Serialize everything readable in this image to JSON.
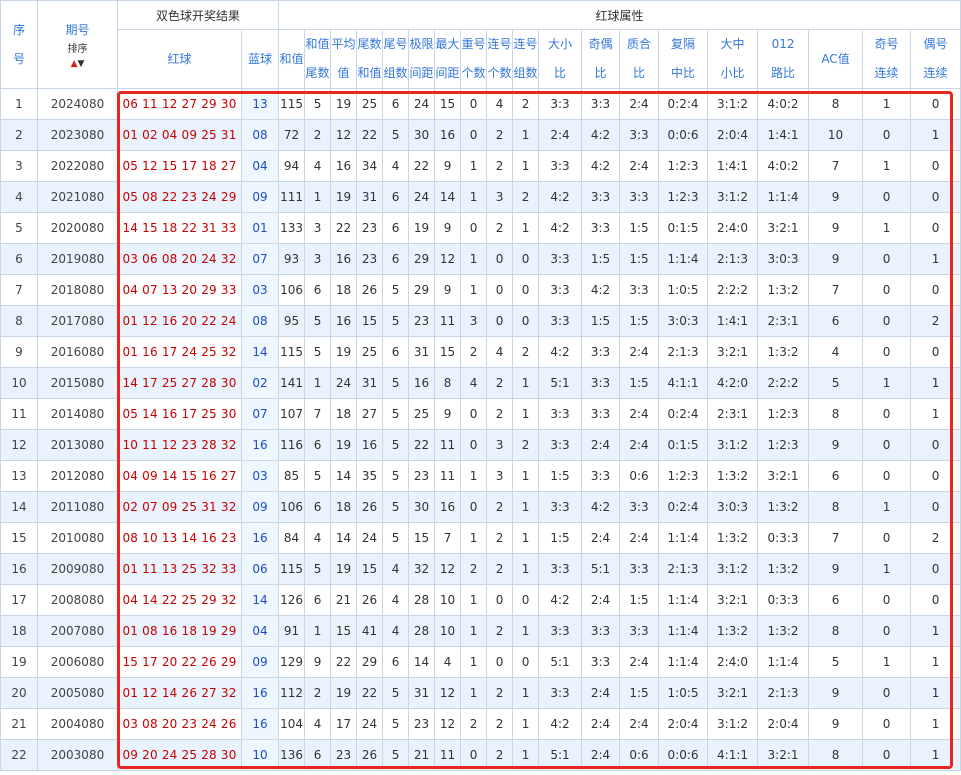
{
  "header": {
    "seq": [
      "序",
      "号"
    ],
    "issue": "期号",
    "sort": "排序",
    "result_group": "双色球开奖结果",
    "red_group": "红球属性",
    "red_ball": "红球",
    "blue_ball": "蓝球",
    "cols": [
      [
        "和值"
      ],
      [
        "和值",
        "尾数"
      ],
      [
        "平均",
        "值"
      ],
      [
        "尾数",
        "和值"
      ],
      [
        "尾号",
        "组数"
      ],
      [
        "极限",
        "间距"
      ],
      [
        "最大",
        "间距"
      ],
      [
        "重号",
        "个数"
      ],
      [
        "连号",
        "个数"
      ],
      [
        "连号",
        "组数"
      ],
      [
        "大小",
        "比"
      ],
      [
        "奇偶",
        "比"
      ],
      [
        "质合",
        "比"
      ],
      [
        "复隔",
        "中比"
      ],
      [
        "大中",
        "小比"
      ],
      [
        "012",
        "路比"
      ],
      [
        "AC值"
      ],
      [
        "奇号",
        "连续"
      ],
      [
        "偶号",
        "连续"
      ]
    ]
  },
  "rows": [
    [
      "1",
      "2024080",
      "06 11 12 27 29 30",
      "13",
      "115",
      "5",
      "19",
      "25",
      "6",
      "24",
      "15",
      "0",
      "4",
      "2",
      "3:3",
      "3:3",
      "2:4",
      "0:2:4",
      "3:1:2",
      "4:0:2",
      "8",
      "1",
      "0"
    ],
    [
      "2",
      "2023080",
      "01 02 04 09 25 31",
      "08",
      "72",
      "2",
      "12",
      "22",
      "5",
      "30",
      "16",
      "0",
      "2",
      "1",
      "2:4",
      "4:2",
      "3:3",
      "0:0:6",
      "2:0:4",
      "1:4:1",
      "10",
      "0",
      "1"
    ],
    [
      "3",
      "2022080",
      "05 12 15 17 18 27",
      "04",
      "94",
      "4",
      "16",
      "34",
      "4",
      "22",
      "9",
      "1",
      "2",
      "1",
      "3:3",
      "4:2",
      "2:4",
      "1:2:3",
      "1:4:1",
      "4:0:2",
      "7",
      "1",
      "0"
    ],
    [
      "4",
      "2021080",
      "05 08 22 23 24 29",
      "09",
      "111",
      "1",
      "19",
      "31",
      "6",
      "24",
      "14",
      "1",
      "3",
      "2",
      "4:2",
      "3:3",
      "3:3",
      "1:2:3",
      "3:1:2",
      "1:1:4",
      "9",
      "0",
      "0"
    ],
    [
      "5",
      "2020080",
      "14 15 18 22 31 33",
      "01",
      "133",
      "3",
      "22",
      "23",
      "6",
      "19",
      "9",
      "0",
      "2",
      "1",
      "4:2",
      "3:3",
      "1:5",
      "0:1:5",
      "2:4:0",
      "3:2:1",
      "9",
      "1",
      "0"
    ],
    [
      "6",
      "2019080",
      "03 06 08 20 24 32",
      "07",
      "93",
      "3",
      "16",
      "23",
      "6",
      "29",
      "12",
      "1",
      "0",
      "0",
      "3:3",
      "1:5",
      "1:5",
      "1:1:4",
      "2:1:3",
      "3:0:3",
      "9",
      "0",
      "1"
    ],
    [
      "7",
      "2018080",
      "04 07 13 20 29 33",
      "03",
      "106",
      "6",
      "18",
      "26",
      "5",
      "29",
      "9",
      "1",
      "0",
      "0",
      "3:3",
      "4:2",
      "3:3",
      "1:0:5",
      "2:2:2",
      "1:3:2",
      "7",
      "0",
      "0"
    ],
    [
      "8",
      "2017080",
      "01 12 16 20 22 24",
      "08",
      "95",
      "5",
      "16",
      "15",
      "5",
      "23",
      "11",
      "3",
      "0",
      "0",
      "3:3",
      "1:5",
      "1:5",
      "3:0:3",
      "1:4:1",
      "2:3:1",
      "6",
      "0",
      "2"
    ],
    [
      "9",
      "2016080",
      "01 16 17 24 25 32",
      "14",
      "115",
      "5",
      "19",
      "25",
      "6",
      "31",
      "15",
      "2",
      "4",
      "2",
      "4:2",
      "3:3",
      "2:4",
      "2:1:3",
      "3:2:1",
      "1:3:2",
      "4",
      "0",
      "0"
    ],
    [
      "10",
      "2015080",
      "14 17 25 27 28 30",
      "02",
      "141",
      "1",
      "24",
      "31",
      "5",
      "16",
      "8",
      "4",
      "2",
      "1",
      "5:1",
      "3:3",
      "1:5",
      "4:1:1",
      "4:2:0",
      "2:2:2",
      "5",
      "1",
      "1"
    ],
    [
      "11",
      "2014080",
      "05 14 16 17 25 30",
      "07",
      "107",
      "7",
      "18",
      "27",
      "5",
      "25",
      "9",
      "0",
      "2",
      "1",
      "3:3",
      "3:3",
      "2:4",
      "0:2:4",
      "2:3:1",
      "1:2:3",
      "8",
      "0",
      "1"
    ],
    [
      "12",
      "2013080",
      "10 11 12 23 28 32",
      "16",
      "116",
      "6",
      "19",
      "16",
      "5",
      "22",
      "11",
      "0",
      "3",
      "2",
      "3:3",
      "2:4",
      "2:4",
      "0:1:5",
      "3:1:2",
      "1:2:3",
      "9",
      "0",
      "0"
    ],
    [
      "13",
      "2012080",
      "04 09 14 15 16 27",
      "03",
      "85",
      "5",
      "14",
      "35",
      "5",
      "23",
      "11",
      "1",
      "3",
      "1",
      "1:5",
      "3:3",
      "0:6",
      "1:2:3",
      "1:3:2",
      "3:2:1",
      "6",
      "0",
      "0"
    ],
    [
      "14",
      "2011080",
      "02 07 09 25 31 32",
      "09",
      "106",
      "6",
      "18",
      "26",
      "5",
      "30",
      "16",
      "0",
      "2",
      "1",
      "3:3",
      "4:2",
      "3:3",
      "0:2:4",
      "3:0:3",
      "1:3:2",
      "8",
      "1",
      "0"
    ],
    [
      "15",
      "2010080",
      "08 10 13 14 16 23",
      "16",
      "84",
      "4",
      "14",
      "24",
      "5",
      "15",
      "7",
      "1",
      "2",
      "1",
      "1:5",
      "2:4",
      "2:4",
      "1:1:4",
      "1:3:2",
      "0:3:3",
      "7",
      "0",
      "2"
    ],
    [
      "16",
      "2009080",
      "01 11 13 25 32 33",
      "06",
      "115",
      "5",
      "19",
      "15",
      "4",
      "32",
      "12",
      "2",
      "2",
      "1",
      "3:3",
      "5:1",
      "3:3",
      "2:1:3",
      "3:1:2",
      "1:3:2",
      "9",
      "1",
      "0"
    ],
    [
      "17",
      "2008080",
      "04 14 22 25 29 32",
      "14",
      "126",
      "6",
      "21",
      "26",
      "4",
      "28",
      "10",
      "1",
      "0",
      "0",
      "4:2",
      "2:4",
      "1:5",
      "1:1:4",
      "3:2:1",
      "0:3:3",
      "6",
      "0",
      "0"
    ],
    [
      "18",
      "2007080",
      "01 08 16 18 19 29",
      "04",
      "91",
      "1",
      "15",
      "41",
      "4",
      "28",
      "10",
      "1",
      "2",
      "1",
      "3:3",
      "3:3",
      "3:3",
      "1:1:4",
      "1:3:2",
      "1:3:2",
      "8",
      "0",
      "1"
    ],
    [
      "19",
      "2006080",
      "15 17 20 22 26 29",
      "09",
      "129",
      "9",
      "22",
      "29",
      "6",
      "14",
      "4",
      "1",
      "0",
      "0",
      "5:1",
      "3:3",
      "2:4",
      "1:1:4",
      "2:4:0",
      "1:1:4",
      "5",
      "1",
      "1"
    ],
    [
      "20",
      "2005080",
      "01 12 14 26 27 32",
      "16",
      "112",
      "2",
      "19",
      "22",
      "5",
      "31",
      "12",
      "1",
      "2",
      "1",
      "3:3",
      "2:4",
      "1:5",
      "1:0:5",
      "3:2:1",
      "2:1:3",
      "9",
      "0",
      "1"
    ],
    [
      "21",
      "2004080",
      "03 08 20 23 24 26",
      "16",
      "104",
      "4",
      "17",
      "24",
      "5",
      "23",
      "12",
      "2",
      "2",
      "1",
      "4:2",
      "2:4",
      "2:4",
      "2:0:4",
      "3:1:2",
      "2:0:4",
      "9",
      "0",
      "1"
    ],
    [
      "22",
      "2003080",
      "09 20 24 25 28 30",
      "10",
      "136",
      "6",
      "23",
      "26",
      "5",
      "21",
      "11",
      "0",
      "2",
      "1",
      "5:1",
      "2:4",
      "0:6",
      "0:0:6",
      "4:1:1",
      "3:2:1",
      "8",
      "0",
      "1"
    ]
  ],
  "colors": {
    "red": "#c80000",
    "blue": "#1a4dcc",
    "highlight": "#e8261f",
    "stripe": "#e8f3fd"
  }
}
